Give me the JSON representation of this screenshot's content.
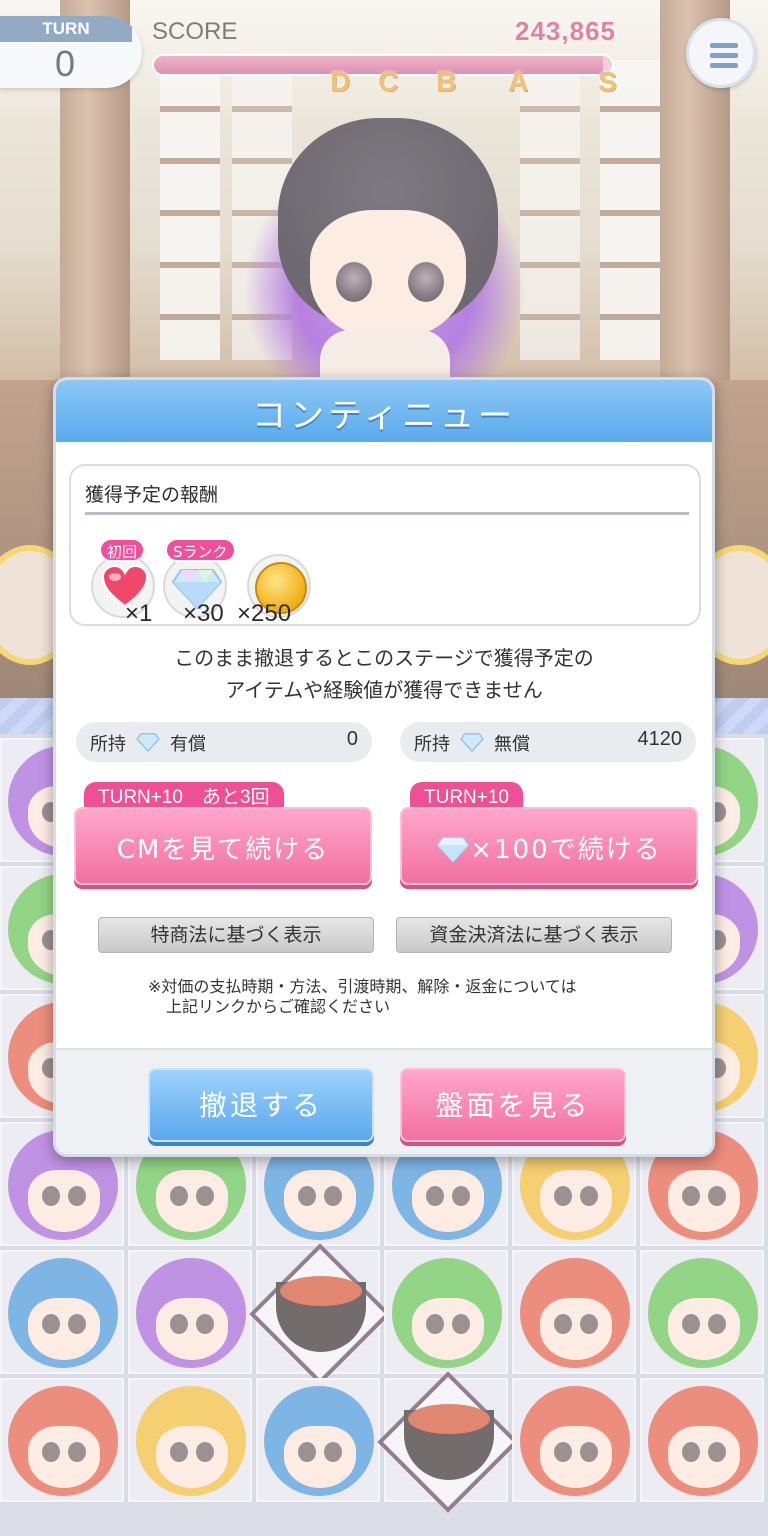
{
  "hud": {
    "turn_label": "TURN",
    "turn_value": "0",
    "score_label": "SCORE",
    "score_value": "243,865",
    "score_progress": 0.98,
    "ranks": [
      "D",
      "C",
      "B",
      "A",
      "S"
    ],
    "menu_icon": "hamburger-menu-icon"
  },
  "dialog": {
    "title": "コンティニュー",
    "rewards_title": "獲得予定の報酬",
    "rewards": [
      {
        "icon": "heart-icon",
        "tag": "初回",
        "qty": "×1"
      },
      {
        "icon": "diamond-gem-icon",
        "tag": "Sランク",
        "qty": "×30"
      },
      {
        "icon": "gold-coin-icon",
        "tag": "",
        "qty": "×250"
      }
    ],
    "warning_line1": "このまま撤退するとこのステージで獲得予定の",
    "warning_line2": "アイテムや経験値が獲得できません",
    "holdings": [
      {
        "label": "所持",
        "type": "有償",
        "value": "0"
      },
      {
        "label": "所持",
        "type": "無償",
        "value": "4120"
      }
    ],
    "continue_ad": {
      "tag": "TURN+10　あと3回",
      "label": "CMを見て続ける"
    },
    "continue_gem": {
      "tag": "TURN+10",
      "label": "×100で続ける"
    },
    "legal_link_1": "特商法に基づく表示",
    "legal_link_2": "資金決済法に基づく表示",
    "note_line1": "※対価の支払時期・方法、引渡時期、解除・返金については",
    "note_line2": "上記リンクからご確認ください",
    "retreat_button": "撤退する",
    "view_board_button": "盤面を見る"
  },
  "colors": {
    "accent_blue": "#5aa9ec",
    "accent_pink": "#f2709f",
    "tag_pink": "#ef4f94"
  }
}
